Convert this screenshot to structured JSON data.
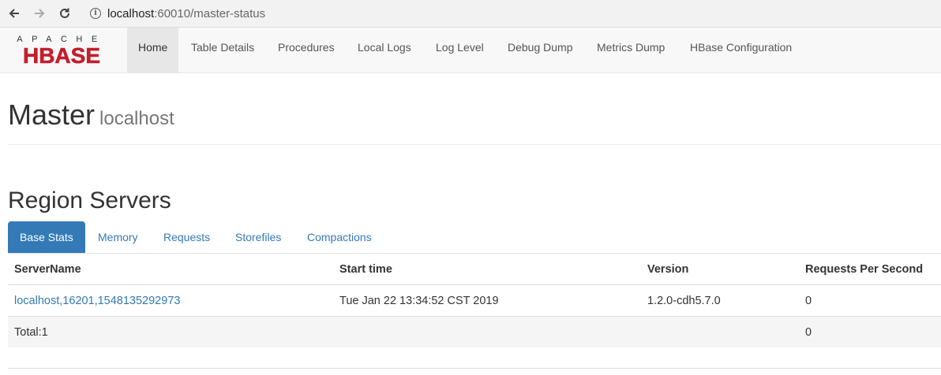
{
  "browser": {
    "url_host": "localhost",
    "url_rest": ":60010/master-status"
  },
  "navbar": {
    "logo_top": "APACHE",
    "logo_main": "HBASE",
    "items": [
      {
        "label": "Home"
      },
      {
        "label": "Table Details"
      },
      {
        "label": "Procedures"
      },
      {
        "label": "Local Logs"
      },
      {
        "label": "Log Level"
      },
      {
        "label": "Debug Dump"
      },
      {
        "label": "Metrics Dump"
      },
      {
        "label": "HBase Configuration"
      }
    ]
  },
  "page": {
    "title": "Master",
    "subtitle": "localhost"
  },
  "region_servers": {
    "title": "Region Servers",
    "tabs": [
      {
        "label": "Base Stats"
      },
      {
        "label": "Memory"
      },
      {
        "label": "Requests"
      },
      {
        "label": "Storefiles"
      },
      {
        "label": "Compactions"
      }
    ],
    "columns": [
      "ServerName",
      "Start time",
      "Version",
      "Requests Per Second"
    ],
    "row": {
      "server": "localhost,16201,1548135292973",
      "start_time": "Tue Jan 22 13:34:52 CST 2019",
      "version": "1.2.0-cdh5.7.0",
      "rps": "0"
    },
    "total": {
      "label": "Total:1",
      "rps": "0"
    }
  }
}
